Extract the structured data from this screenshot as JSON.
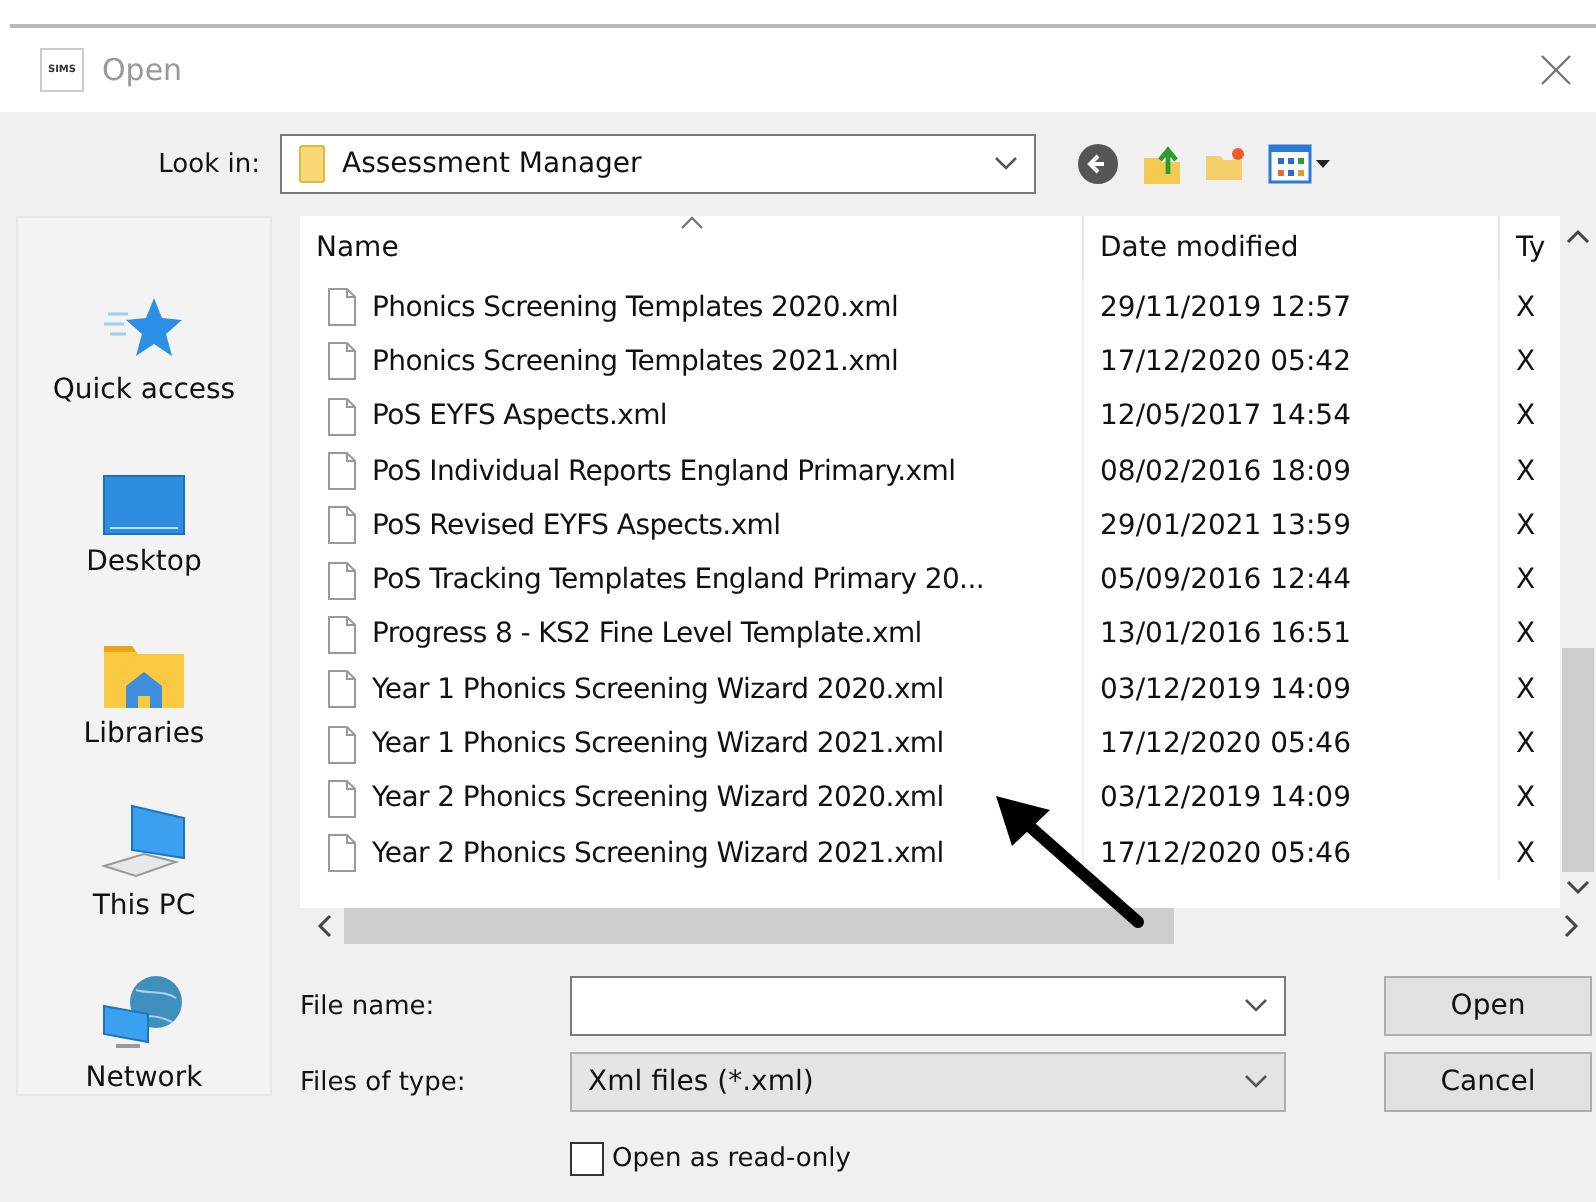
{
  "window": {
    "title": "Open",
    "app_badge": "SIMS"
  },
  "look_in": {
    "label": "Look in:",
    "value": "Assessment Manager"
  },
  "places": [
    {
      "label": "Quick access",
      "kind": "star"
    },
    {
      "label": "Desktop",
      "kind": "desktop"
    },
    {
      "label": "Libraries",
      "kind": "libraries"
    },
    {
      "label": "This PC",
      "kind": "pc"
    },
    {
      "label": "Network",
      "kind": "network"
    }
  ],
  "columns": [
    {
      "label": "Name"
    },
    {
      "label": "Date modified"
    },
    {
      "label": "Ty"
    }
  ],
  "files": [
    {
      "name": "Phonics Screening Templates 2020.xml",
      "date": "29/11/2019 12:57",
      "type": "X"
    },
    {
      "name": "Phonics Screening Templates 2021.xml",
      "date": "17/12/2020 05:42",
      "type": "X"
    },
    {
      "name": "PoS EYFS Aspects.xml",
      "date": "12/05/2017 14:54",
      "type": "X"
    },
    {
      "name": "PoS Individual Reports England Primary.xml",
      "date": "08/02/2016 18:09",
      "type": "X"
    },
    {
      "name": "PoS Revised EYFS Aspects.xml",
      "date": "29/01/2021 13:59",
      "type": "X"
    },
    {
      "name": "PoS Tracking Templates England Primary 20...",
      "date": "05/09/2016 12:44",
      "type": "X"
    },
    {
      "name": "Progress 8 - KS2 Fine Level Template.xml",
      "date": "13/01/2016 16:51",
      "type": "X"
    },
    {
      "name": "Year 1 Phonics Screening Wizard 2020.xml",
      "date": "03/12/2019 14:09",
      "type": "X"
    },
    {
      "name": "Year 1 Phonics Screening Wizard 2021.xml",
      "date": "17/12/2020 05:46",
      "type": "X"
    },
    {
      "name": "Year 2 Phonics Screening Wizard 2020.xml",
      "date": "03/12/2019 14:09",
      "type": "X"
    },
    {
      "name": "Year 2 Phonics Screening Wizard 2021.xml",
      "date": "17/12/2020 05:46",
      "type": "X"
    }
  ],
  "file_name": {
    "label": "File name:"
  },
  "file_type": {
    "label": "Files of type:",
    "value": "Xml files (*.xml)"
  },
  "read_only": {
    "label": "Open as read-only",
    "checked": false
  },
  "buttons": [
    {
      "label": "Open"
    },
    {
      "label": "Cancel"
    }
  ]
}
